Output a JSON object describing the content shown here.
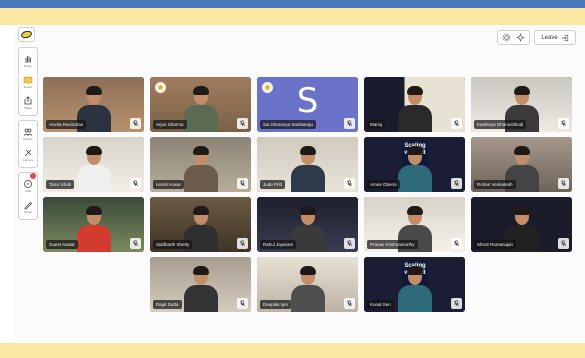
{
  "toolbar": {
    "tools": [
      {
        "icon": "hand-raise-icon",
        "label": "Raise"
      },
      {
        "icon": "emoji-icon",
        "label": "React"
      },
      {
        "icon": "share-icon",
        "label": "Share"
      },
      {
        "icon": "people-icon",
        "label": "People"
      },
      {
        "icon": "camera-icon",
        "label": "Camera"
      },
      {
        "icon": "chat-icon",
        "label": "Chat"
      },
      {
        "icon": "pencil-icon",
        "label": "Notes"
      }
    ]
  },
  "header": {
    "settings_icon": "gear-icon",
    "effects_icon": "sparkle-icon",
    "leave_label": "Leave"
  },
  "participants": [
    {
      "name": "Anvita Ravindran",
      "muted": true
    },
    {
      "name": "Arjun Sharma",
      "muted": true,
      "starred": true
    },
    {
      "name": "Sai Sharanya Sambaraju",
      "muted": true,
      "starred": true,
      "avatar_letter": "S"
    },
    {
      "name": "Manoj",
      "muted": true
    },
    {
      "name": "Kartikeya Dhanushkodi",
      "muted": true
    },
    {
      "name": "Tanvi Shah",
      "muted": true
    },
    {
      "name": "Harsh Kasar",
      "muted": true
    },
    {
      "name": "Jude Pritt",
      "muted": true
    },
    {
      "name": "Arnav Oberoi",
      "muted": true,
      "poster": "Scaling without"
    },
    {
      "name": "Rohan Venkatesh",
      "muted": true
    },
    {
      "name": "Guest Avatar",
      "muted": true
    },
    {
      "name": "Siddharth Shetty",
      "muted": true
    },
    {
      "name": "Rahul Jayaram",
      "muted": true
    },
    {
      "name": "Pranav Krishnamurthy",
      "muted": true
    },
    {
      "name": "Shruti Ramanujan",
      "muted": true
    },
    {
      "name": "Rajat Dutta",
      "muted": true
    },
    {
      "name": "Deepika Iyer",
      "muted": true
    },
    {
      "name": "Kunal Sen",
      "muted": true,
      "poster": "Scaling without"
    }
  ]
}
